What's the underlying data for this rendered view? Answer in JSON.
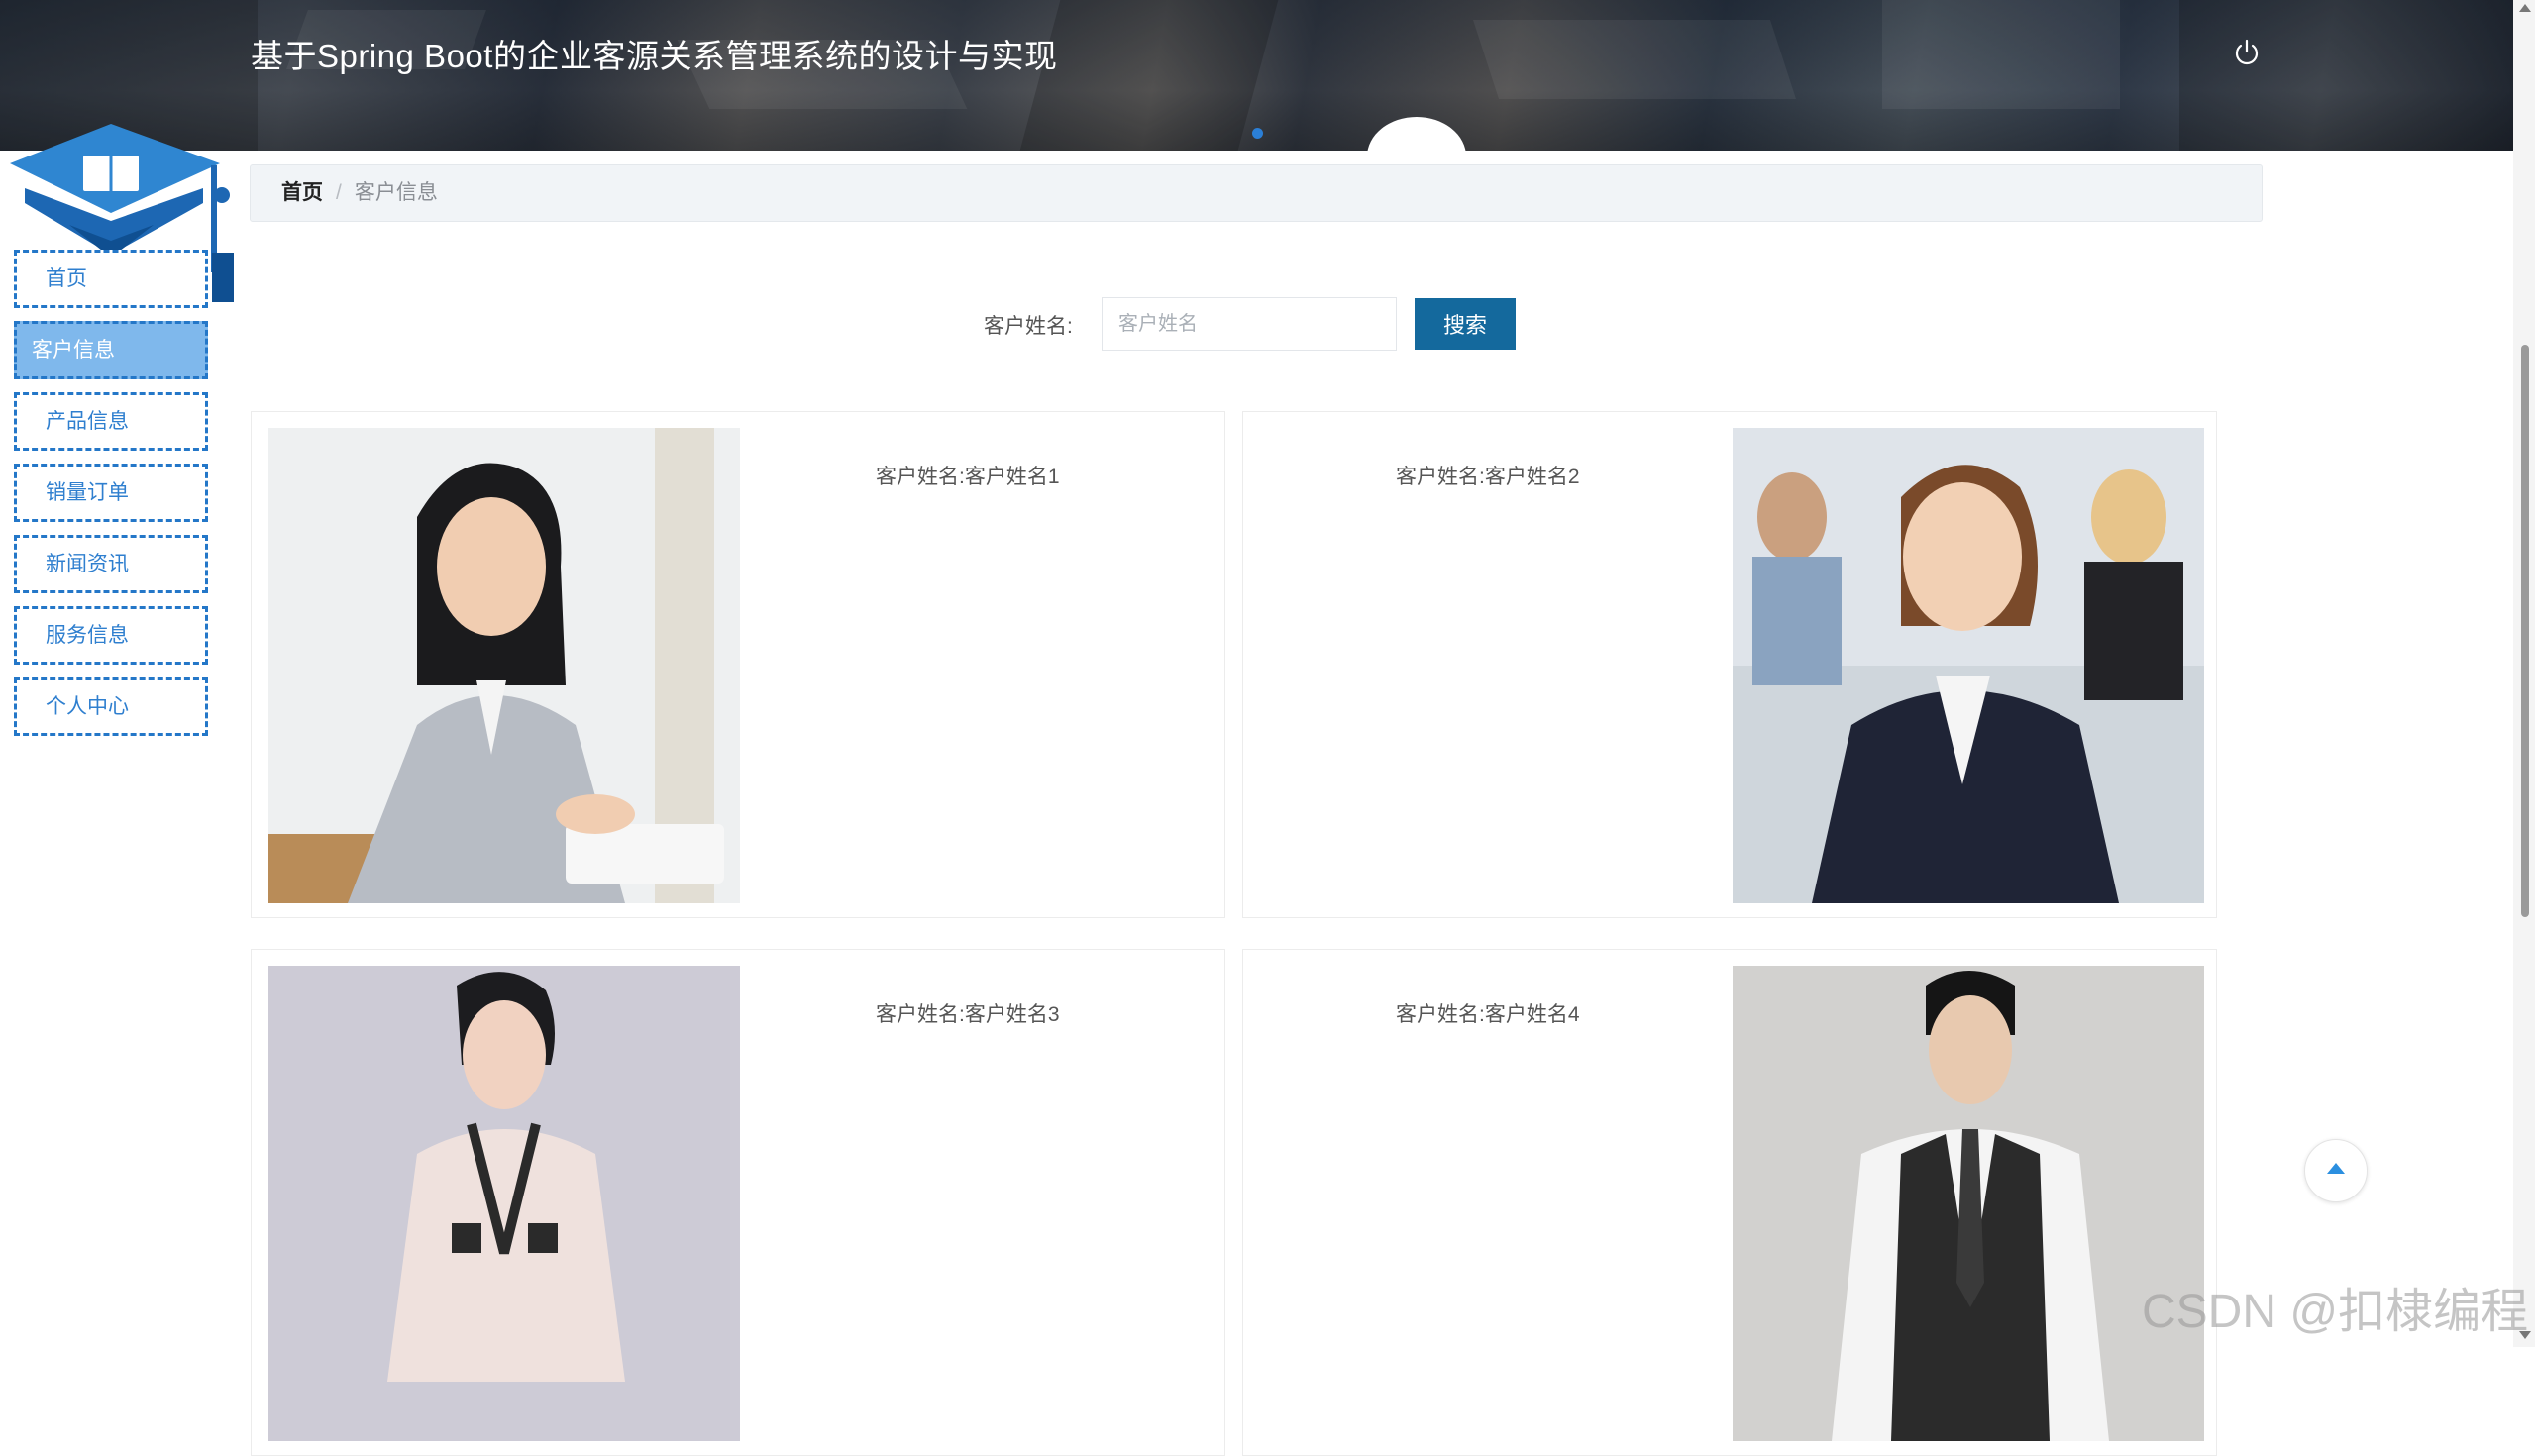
{
  "header": {
    "title": "基于Spring Boot的企业客源关系管理系统的设计与实现",
    "logout_icon": "power-icon"
  },
  "sidebar": {
    "items": [
      {
        "label": "首页",
        "active": false
      },
      {
        "label": "客户信息",
        "active": true
      },
      {
        "label": "产品信息",
        "active": false
      },
      {
        "label": "销量订单",
        "active": false
      },
      {
        "label": "新闻资讯",
        "active": false
      },
      {
        "label": "服务信息",
        "active": false
      },
      {
        "label": "个人中心",
        "active": false
      }
    ]
  },
  "breadcrumb": {
    "home": "首页",
    "separator": "/",
    "current": "客户信息"
  },
  "search": {
    "label": "客户姓名:",
    "placeholder": "客户姓名",
    "value": "",
    "button": "搜索"
  },
  "customers": [
    {
      "name": "客户姓名:客户姓名1",
      "photo": "woman-headset-photo"
    },
    {
      "name": "客户姓名:客户姓名2",
      "photo": "woman-office-photo"
    },
    {
      "name": "客户姓名:客户姓名3",
      "photo": "woman-dress-photo"
    },
    {
      "name": "客户姓名:客户姓名4",
      "photo": "man-vest-photo"
    }
  ],
  "watermark": "CSDN @扣棣编程",
  "colors": {
    "accent": "#14699d",
    "sidebar_border": "#2477c8",
    "sidebar_active": "#7fb8ec"
  }
}
